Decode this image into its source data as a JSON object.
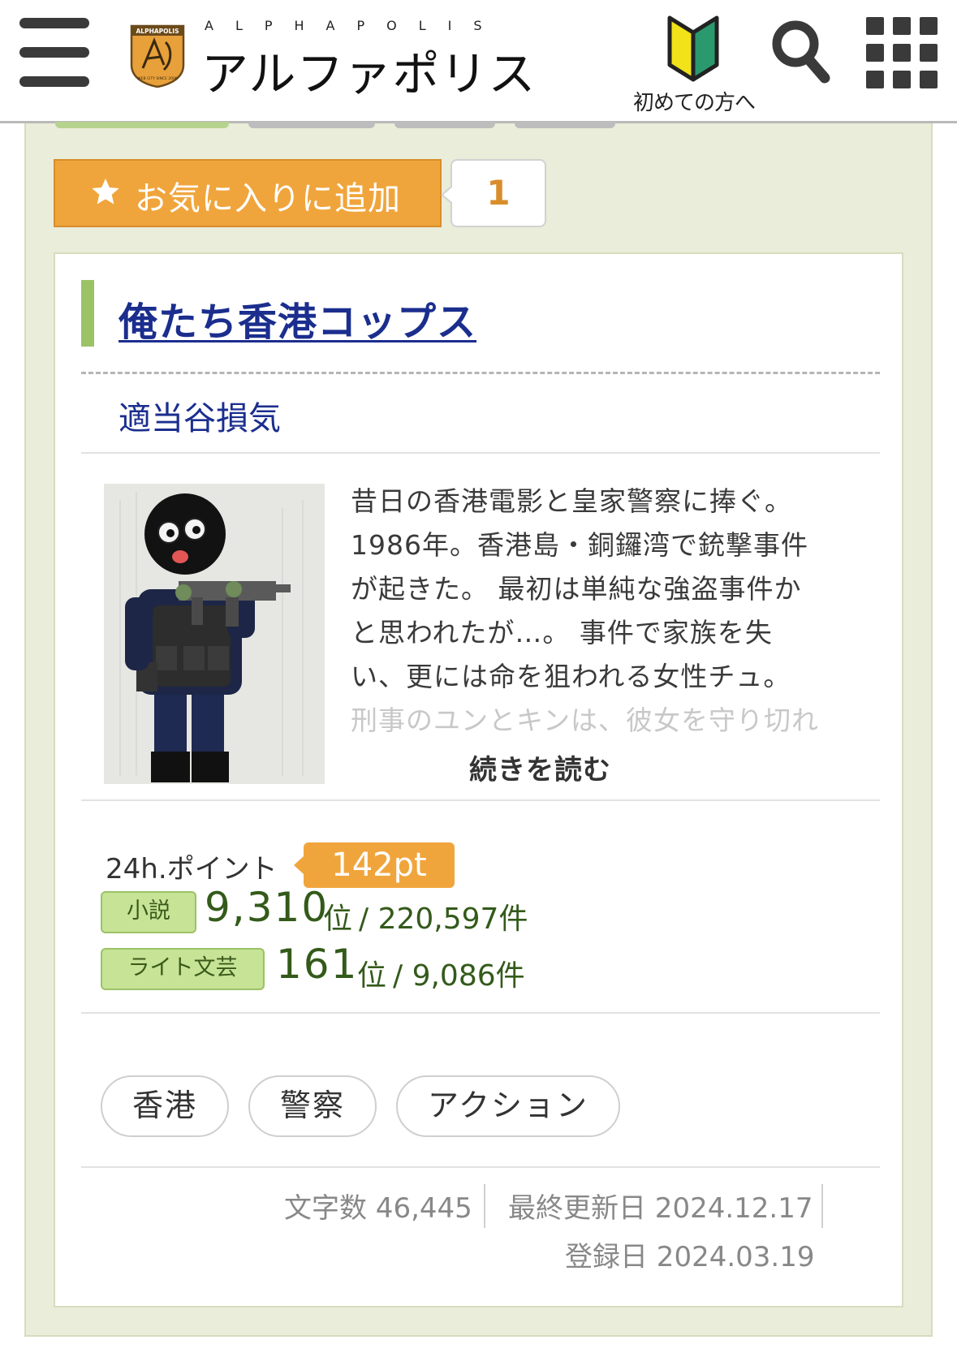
{
  "header": {
    "logo_badge_text": "ALPHAPOLIS",
    "logo_badge_sub": "WEB CITY SINCE 2000",
    "logo_en": "ALPHAPOLIS",
    "logo_ja": "アルファポリス",
    "beginner_label": "初めての方へ",
    "icons": [
      "menu-icon",
      "beginner-mark-icon",
      "search-icon",
      "grid-menu-icon"
    ]
  },
  "favorite": {
    "label": "お気に入りに追加",
    "count": "1"
  },
  "novel": {
    "title": "俺たち香港コップス",
    "author": "適当谷損気",
    "synopsis_lines": [
      "昔日の香港電影と皇家警察に捧ぐ。",
      "1986年。香港島・銅鑼湾で銃撃事件",
      "が起きた。 最初は単純な強盗事件か",
      "と思われたが…。 事件で家族を失",
      "い、更には命を狙われる女性チュ。",
      "刑事のユンとキンは、彼女を守り切れ"
    ],
    "read_more": "続きを読む"
  },
  "stats": {
    "points_label": "24h.ポイント",
    "points_value": "142pt",
    "rankings": [
      {
        "tag": "小説",
        "rank": "9,310",
        "unit": "位",
        "total": "/ 220,597件"
      },
      {
        "tag": "ライト文芸",
        "rank": "161",
        "unit": "位",
        "total": "/ 9,086件"
      }
    ]
  },
  "tags": [
    "香港",
    "警察",
    "アクション"
  ],
  "meta": {
    "char_count": "文字数 46,445",
    "last_updated": "最終更新日 2024.12.17",
    "registered": "登録日 2024.03.19"
  },
  "colors": {
    "accent_orange": "#f0a53c",
    "title_blue": "#1b2e8e",
    "green_bar": "#9cc266",
    "panel_bg": "#e9edd9",
    "rank_green": "#335a1a"
  }
}
